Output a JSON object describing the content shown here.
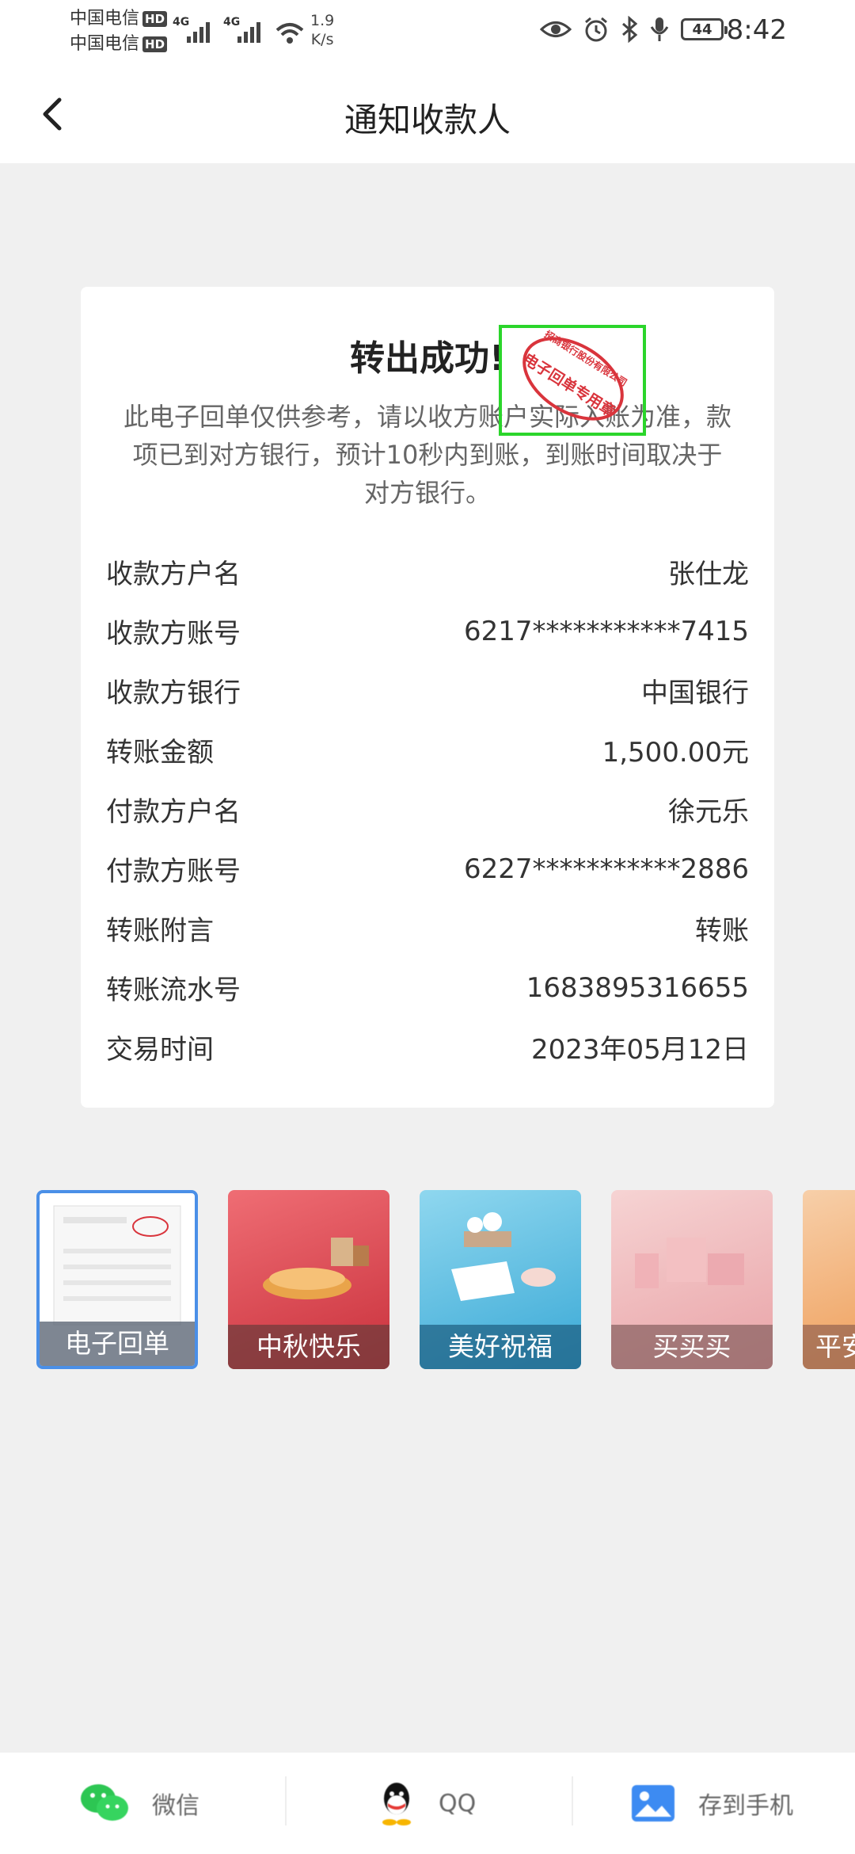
{
  "status_bar": {
    "carrier1": "中国电信",
    "carrier2": "中国电信",
    "hd": "HD",
    "net1": "4G",
    "net2": "4G",
    "speed_value": "1.9",
    "speed_unit": "K/s",
    "battery": "44",
    "time": "8:42"
  },
  "nav": {
    "title": "通知收款人"
  },
  "receipt": {
    "title": "转出成功!",
    "notice": "此电子回单仅供参考，请以收方账户实际入账为准，款项已到对方银行，预计10秒内到账，到账时间取决于对方银行。",
    "stamp": {
      "text_arc": "招商银行股份有限公司",
      "text_center": "电子回单专用章"
    },
    "rows": [
      {
        "label": "收款方户名",
        "value": "张仕龙"
      },
      {
        "label": "收款方账号",
        "value": "6217***********7415"
      },
      {
        "label": "收款方银行",
        "value": "中国银行"
      },
      {
        "label": "转账金额",
        "value": "1,500.00元"
      },
      {
        "label": "付款方户名",
        "value": "徐元乐"
      },
      {
        "label": "付款方账号",
        "value": "6227***********2886"
      },
      {
        "label": "转账附言",
        "value": "转账"
      },
      {
        "label": "转账流水号",
        "value": "1683895316655"
      },
      {
        "label": "交易时间",
        "value": "2023年05月12日"
      }
    ]
  },
  "templates": [
    {
      "label": "电子回单"
    },
    {
      "label": "中秋快乐"
    },
    {
      "label": "美好祝福"
    },
    {
      "label": "买买买"
    },
    {
      "label": "平安"
    }
  ],
  "share": [
    {
      "label": "微信",
      "icon": "wechat-icon"
    },
    {
      "label": "QQ",
      "icon": "qq-icon"
    },
    {
      "label": "存到手机",
      "icon": "gallery-icon"
    }
  ],
  "colors": {
    "stamp_red": "#d9343c",
    "highlight_green": "#2bd52b",
    "selected_blue": "#4a8fe7"
  }
}
